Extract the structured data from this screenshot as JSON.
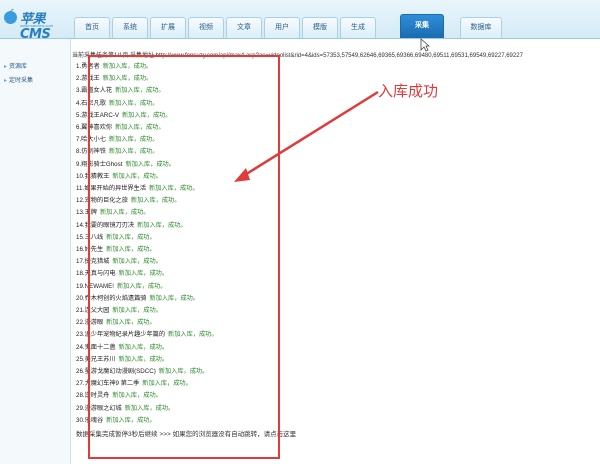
{
  "logo": {
    "text": "苹果CMS",
    "url": "www.maccms.com"
  },
  "nav": {
    "items": [
      {
        "label": "首页"
      },
      {
        "label": "系统"
      },
      {
        "label": "扩展"
      },
      {
        "label": "视频"
      },
      {
        "label": "文章"
      },
      {
        "label": "用户"
      },
      {
        "label": "模版"
      },
      {
        "label": "生成"
      },
      {
        "label": "采集",
        "active": true
      },
      {
        "label": "数据库"
      }
    ]
  },
  "sidebar": {
    "items": [
      {
        "label": "资源库"
      },
      {
        "label": "定时采集"
      }
    ]
  },
  "main": {
    "top_line": "当前采集任务第1/1页 采集地址 http://www.fensuzy.com/api/max4.asp?ac=videolist&rid=4&ids=57353,57549,62646,69365,69366,69480,69511,69531,69549,69227,69227",
    "rows": [
      {
        "num": "1.",
        "title": "勇者者",
        "action": "新加入库",
        "status": "成功。"
      },
      {
        "num": "2.",
        "title": "游戏王",
        "action": "新加入库",
        "status": "成功。"
      },
      {
        "num": "3.",
        "title": "霸道女人花",
        "action": "新加入库",
        "status": "成功。"
      },
      {
        "num": "4.",
        "title": "石尼凡歌",
        "action": "新加入库",
        "status": "成功。"
      },
      {
        "num": "5.",
        "title": "游戏王ARC-V",
        "action": "新加入库",
        "status": "成功。"
      },
      {
        "num": "6.",
        "title": "翼神喜欢你",
        "action": "新加入库",
        "status": "成功。"
      },
      {
        "num": "7.",
        "title": "哈大小七",
        "action": "新加入库",
        "status": "成功。"
      },
      {
        "num": "8.",
        "title": "仿制神铁",
        "action": "新加入库",
        "status": "成功。"
      },
      {
        "num": "9.",
        "title": "翔影骑士Ghost",
        "action": "新加入库",
        "status": "成功。"
      },
      {
        "num": "10.",
        "title": "我猜教王",
        "action": "新加入库",
        "status": "成功。"
      },
      {
        "num": "11.",
        "title": "如果开始的异世界生活",
        "action": "新加入库",
        "status": "成功。"
      },
      {
        "num": "12.",
        "title": "宠物的巨化之旅",
        "action": "新加入库",
        "status": "成功。"
      },
      {
        "num": "13.",
        "title": "王牌",
        "action": "新加入库",
        "status": "成功。"
      },
      {
        "num": "14.",
        "title": "我要的眼镜刀刃决",
        "action": "新加入库",
        "status": "成功。"
      },
      {
        "num": "15.",
        "title": "三八线",
        "action": "新加入库",
        "status": "成功。"
      },
      {
        "num": "16.",
        "title": "好先生",
        "action": "新加入库",
        "status": "成功。"
      },
      {
        "num": "17.",
        "title": "捷克猎城",
        "action": "新加入库",
        "status": "成功。"
      },
      {
        "num": "18.",
        "title": "天真与闪电",
        "action": "新加入库",
        "status": "成功。"
      },
      {
        "num": "19.",
        "title": "NEWAME!",
        "action": "新加入库",
        "status": "成功。"
      },
      {
        "num": "20.",
        "title": "乔木柯创的火焰遗篇骑",
        "action": "新加入库",
        "status": "成功。"
      },
      {
        "num": "21.",
        "title": "连父大园",
        "action": "新加入库",
        "status": "成功。"
      },
      {
        "num": "22.",
        "title": "漫游眼",
        "action": "新加入库",
        "status": "成功。"
      },
      {
        "num": "23.",
        "title": "追少年宠物纪录片趣少年篇的",
        "action": "新加入库",
        "status": "成功。"
      },
      {
        "num": "24.",
        "title": "鬼面十二盏",
        "action": "新加入库",
        "status": "成功。"
      },
      {
        "num": "25.",
        "title": "美兄王苏川",
        "action": "新加入库",
        "status": "成功。"
      },
      {
        "num": "26.",
        "title": "星游戈魔幻动漫剧(SDCC)",
        "action": "新加入库",
        "status": "成功。"
      },
      {
        "num": "27.",
        "title": "大魔幻车神9 第二季",
        "action": "新加入库",
        "status": "成功。"
      },
      {
        "num": "28.",
        "title": "逆时灵舟",
        "action": "新加入库",
        "status": "成功。"
      },
      {
        "num": "29.",
        "title": "漫游眼之幻城",
        "action": "新加入库",
        "status": "成功。"
      },
      {
        "num": "30.",
        "title": "乐魂谷",
        "action": "新加入库",
        "status": "成功。"
      }
    ],
    "footer_line": "数据采集完成暂停3秒后继续 >>> 如果您的浏览器没有自动跳转，请点击这里"
  },
  "annotation": {
    "label": "入库成功",
    "color": "#e03a3a"
  }
}
